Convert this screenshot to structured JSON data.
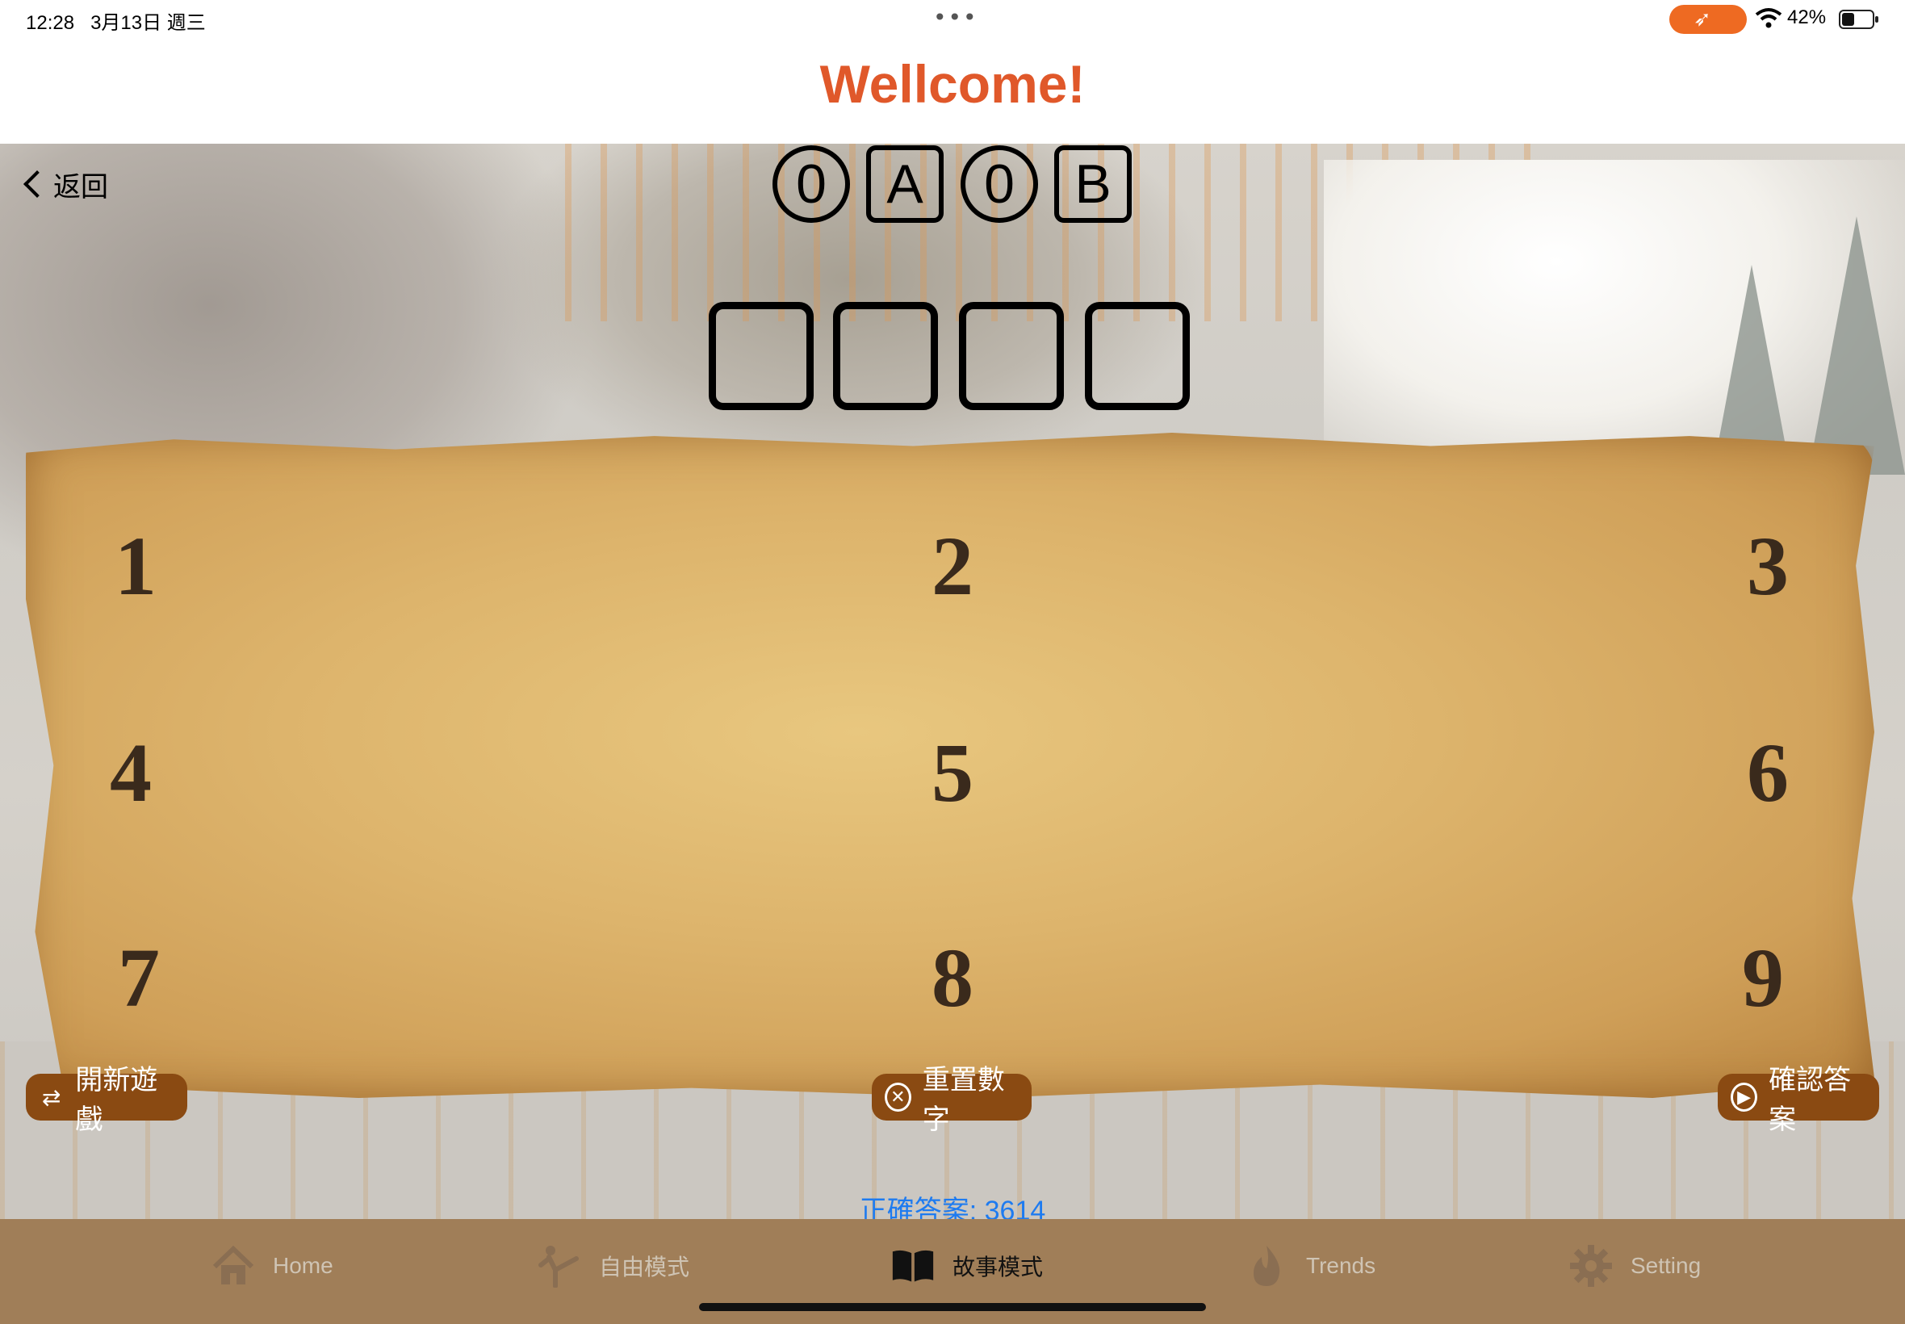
{
  "status_bar": {
    "time": "12:28",
    "date": "3月13日 週三",
    "battery_percent": "42%",
    "battery_level": 0.42,
    "swift_icon": "swift-icon",
    "wifi_icon": "wifi-icon"
  },
  "header": {
    "title": "Wellcome!"
  },
  "nav": {
    "back_label": "返回"
  },
  "score": {
    "a_count": "0",
    "a_letter": "A",
    "b_count": "0",
    "b_letter": "B"
  },
  "guess_slots": [
    "",
    "",
    "",
    ""
  ],
  "keypad": [
    "1",
    "2",
    "3",
    "4",
    "5",
    "6",
    "7",
    "8",
    "9"
  ],
  "actions": {
    "new_game": "開新遊戲",
    "reset": "重置數字",
    "confirm": "確認答案"
  },
  "answer_text": "正確答案: 3614",
  "tabs": [
    {
      "label": "Home",
      "icon": "house-icon",
      "active": false
    },
    {
      "label": "自由模式",
      "icon": "figure-kick-icon",
      "active": false
    },
    {
      "label": "故事模式",
      "icon": "book-icon",
      "active": true
    },
    {
      "label": "Trends",
      "icon": "flame-icon",
      "active": false
    },
    {
      "label": "Setting",
      "icon": "gear-icon",
      "active": false
    }
  ],
  "colors": {
    "title": "#e0582a",
    "button_bg": "#8a4a12",
    "answer_text": "#1e7bf0",
    "tab_bar_bg": "#a07e58"
  }
}
